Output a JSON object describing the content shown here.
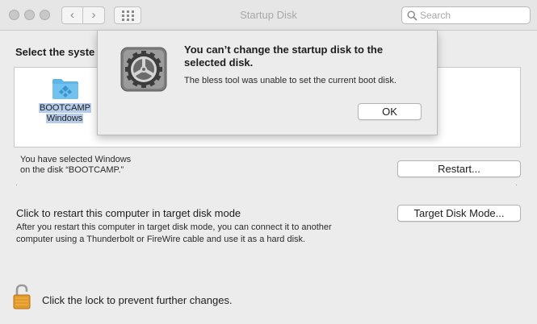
{
  "window": {
    "title": "Startup Disk",
    "search_placeholder": "Search",
    "nav_back": "‹",
    "nav_fwd": "›"
  },
  "main": {
    "select_heading": "Select the syste",
    "disk": {
      "name_line1": "BOOTCAMP",
      "name_line2": "Windows",
      "icon": "windows-folder-icon"
    },
    "selected_line1": "You have selected Windows",
    "selected_line2": "on the disk “BOOTCAMP.”",
    "restart_button": "Restart...",
    "target_mode_title": "Click to restart this computer in target disk mode",
    "target_mode_desc": "After you restart this computer in target disk mode, you can connect it to another computer using a Thunderbolt or FireWire cable and use it as a hard disk.",
    "target_mode_button": "Target Disk Mode...",
    "lock_text": "Click the lock to prevent further changes."
  },
  "dialog": {
    "title": "You can’t change the startup disk to the selected disk.",
    "message": "The bless tool was unable to set the current boot disk.",
    "ok_button": "OK",
    "icon": "system-preferences-gear-icon"
  },
  "colors": {
    "selection_highlight": "#b5cdea",
    "folder_blue": "#5fb4e8"
  }
}
